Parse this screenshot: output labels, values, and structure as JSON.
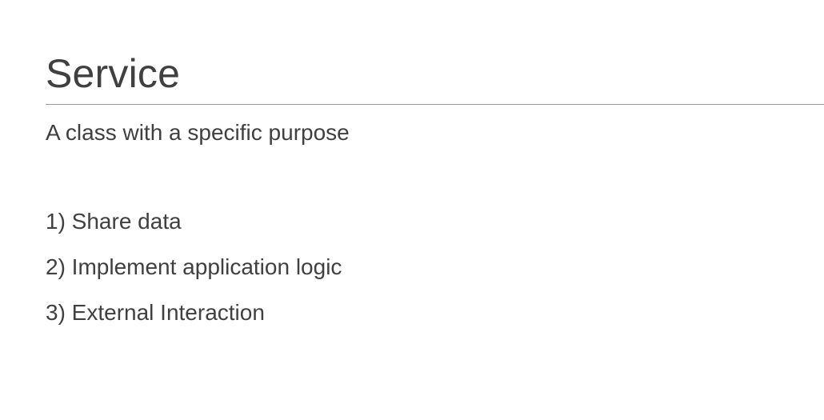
{
  "slide": {
    "title": "Service",
    "subtitle": "A class with a specific purpose",
    "items": [
      "1) Share data",
      "2) Implement application logic",
      "3) External Interaction"
    ]
  },
  "colors": {
    "text": "#404040",
    "rule": "#9a9a9a",
    "background": "#ffffff"
  }
}
